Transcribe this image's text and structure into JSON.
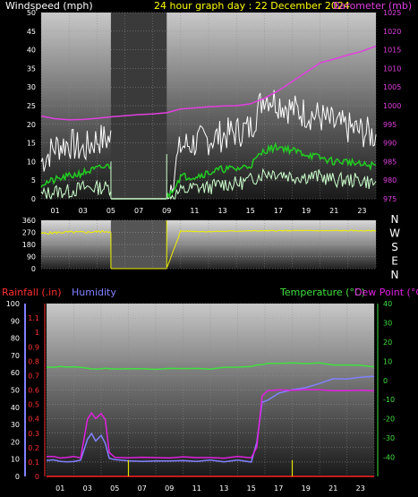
{
  "colors": {
    "wind_gust": "#ffffff",
    "wind_avg": "#22cc22",
    "wind_min": "#ccffcc",
    "barometer": "#e040e0",
    "direction": "#f0f000",
    "rainfall": "#ff2020",
    "humidity": "#8080ff",
    "temperature": "#40e040",
    "dewpoint": "#e020e0",
    "title": "#ffff00",
    "rain_ticks": "#ff3030",
    "humidity_ticks": "#8080ff",
    "temp_ticks": "#40e040"
  },
  "chart_data": [
    {
      "type": "line",
      "panel": "wind_barometer",
      "title": "24 hour graph day : 22 December 2024",
      "ylabel": "Windspeed (mph)",
      "y2label": "Barometer (mb)",
      "ylim": [
        0,
        50
      ],
      "y2lim": [
        975,
        1025
      ],
      "yticks": [
        "0",
        "5",
        "10",
        "15",
        "20",
        "25",
        "30",
        "35",
        "40",
        "45",
        "50"
      ],
      "y2ticks": [
        "975",
        "980",
        "985",
        "990",
        "995",
        "1000",
        "1005",
        "1010",
        "1015",
        "1020",
        "1025"
      ],
      "xticks": [
        "01",
        "03",
        "05",
        "07",
        "09",
        "11",
        "13",
        "15",
        "17",
        "19",
        "21",
        "23"
      ],
      "x": [
        0,
        1,
        2,
        3,
        4,
        5,
        6,
        7,
        8,
        9,
        10,
        11,
        12,
        13,
        14,
        15,
        16,
        17,
        18,
        19,
        20,
        21,
        22,
        23,
        24
      ],
      "gap": [
        5,
        9
      ],
      "series": [
        {
          "key": "gust",
          "values": [
            10,
            14,
            15,
            13,
            16,
            16,
            0,
            0,
            0,
            0,
            14,
            15,
            16,
            17,
            18,
            19,
            28,
            26,
            24,
            23,
            22,
            20,
            19,
            18,
            17
          ]
        },
        {
          "key": "avg",
          "values": [
            4,
            5,
            6,
            7,
            8,
            9,
            0,
            0,
            0,
            0,
            6,
            6,
            7,
            8,
            8,
            9,
            13,
            14,
            13,
            12,
            11,
            10,
            10,
            9,
            9
          ]
        },
        {
          "key": "min",
          "values": [
            1,
            2,
            2,
            3,
            3,
            3,
            0,
            0,
            0,
            0,
            2,
            3,
            3,
            4,
            4,
            5,
            7,
            7,
            6,
            6,
            6,
            5,
            5,
            5,
            4
          ]
        },
        {
          "key": "barometer",
          "values": [
            997.2,
            996.5,
            996.2,
            996.3,
            996.6,
            997,
            997.3,
            997.6,
            997.8,
            998.1,
            999.1,
            999.4,
            999.7,
            999.9,
            1000,
            1000.5,
            1002,
            1004,
            1006.5,
            1009,
            1011.5,
            1012.5,
            1013.6,
            1014.6,
            1016
          ]
        }
      ]
    },
    {
      "type": "line",
      "panel": "direction",
      "ylim": [
        0,
        360
      ],
      "yticks": [
        "0",
        "90",
        "180",
        "270",
        "360"
      ],
      "compass": [
        "N",
        "W",
        "S",
        "E",
        "N"
      ],
      "x": [
        0,
        1,
        2,
        3,
        4,
        5,
        6,
        7,
        8,
        9,
        10,
        11,
        12,
        13,
        14,
        15,
        16,
        17,
        18,
        19,
        20,
        21,
        22,
        23,
        24
      ],
      "gap": [
        5,
        9
      ],
      "values": [
        262,
        268,
        272,
        270,
        275,
        278,
        0,
        0,
        0,
        0,
        280,
        278,
        276,
        278,
        280,
        281,
        282,
        282,
        283,
        283,
        282,
        283,
        283,
        282,
        282
      ]
    },
    {
      "type": "line",
      "panel": "rain_humidity_temp",
      "labels": {
        "rainfall": "Rainfall (.in)",
        "humidity": "Humidity",
        "temperature": "Temperature (°C)",
        "dewpoint": "Dew Point (°C)"
      },
      "rain_lim": [
        0,
        1.2
      ],
      "rain_ticks": [
        "0",
        "0.1",
        "0.2",
        "0.3",
        "0.4",
        "0.5",
        "0.6",
        "0.7",
        "0.8",
        "0.9",
        "1",
        "1.1"
      ],
      "humidity_lim": [
        0,
        100
      ],
      "humidity_ticks": [
        "0",
        "10",
        "20",
        "30",
        "40",
        "50",
        "60",
        "70",
        "80",
        "90",
        "100"
      ],
      "temp_lim": [
        -50,
        40
      ],
      "temp_ticks": [
        "-40",
        "-30",
        "-20",
        "-10",
        "0",
        "10",
        "20",
        "30",
        "40"
      ],
      "xticks": [
        "01",
        "03",
        "05",
        "07",
        "09",
        "11",
        "13",
        "15",
        "17",
        "19",
        "21",
        "23"
      ],
      "x": [
        0,
        0.5,
        1,
        1.5,
        2,
        2.5,
        3,
        3.3,
        3.6,
        4,
        4.3,
        4.6,
        5,
        6,
        7,
        8,
        9,
        10,
        11,
        12,
        13,
        14,
        15,
        15.4,
        15.8,
        16.2,
        17,
        18,
        19,
        20,
        21,
        22,
        23,
        24
      ],
      "series": [
        {
          "key": "humidity",
          "values": [
            9,
            9,
            9,
            9,
            9,
            9,
            22,
            25,
            20,
            24,
            19,
            10,
            9,
            9,
            9,
            9,
            9,
            9,
            9,
            9,
            9,
            9,
            9,
            20,
            43,
            44,
            48,
            50,
            51,
            54,
            56,
            57,
            58,
            58
          ]
        },
        {
          "key": "dewpoint",
          "values": [
            -40,
            -40,
            -40,
            -40,
            -40,
            -40,
            -20,
            -17,
            -20,
            -17,
            -20,
            -38,
            -40,
            -40,
            -40,
            -40,
            -40,
            -40,
            -40,
            -40,
            -40,
            -40,
            -40,
            -35,
            -8,
            -5,
            -5,
            -5,
            -5,
            -5,
            -5,
            -5,
            -5,
            -5
          ]
        },
        {
          "key": "temperature",
          "values": [
            7,
            7,
            7,
            7,
            7,
            7,
            6,
            6,
            6,
            6,
            6,
            6,
            6,
            6,
            6,
            6,
            6,
            6,
            6,
            6,
            7,
            7,
            7,
            8,
            8,
            9,
            9,
            9,
            9,
            9,
            8,
            8,
            8,
            7
          ]
        },
        {
          "key": "rainfall",
          "values": [
            0,
            0,
            0,
            0,
            0,
            0,
            0,
            0,
            0,
            0,
            0,
            0,
            0,
            0,
            0,
            0,
            0,
            0,
            0,
            0,
            0,
            0,
            0,
            0,
            0,
            0,
            0,
            0,
            0,
            0,
            0,
            0,
            0,
            0
          ]
        }
      ],
      "markers": [
        6,
        18
      ]
    }
  ]
}
